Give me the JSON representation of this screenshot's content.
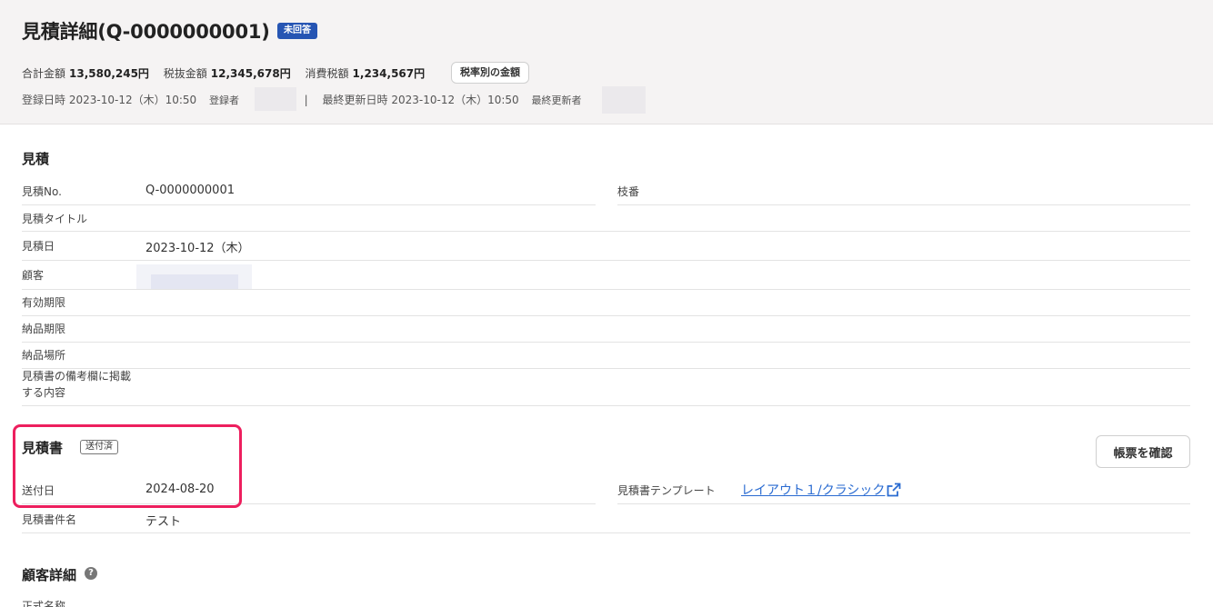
{
  "header": {
    "title": "見積詳細(Q-0000000001)",
    "status_badge": "未回答",
    "amounts": [
      {
        "label": "合計金額",
        "value": "13,580,245円"
      },
      {
        "label": "税抜金額",
        "value": "12,345,678円"
      },
      {
        "label": "消費税額",
        "value": "1,234,567円"
      }
    ],
    "tax_button": "税率別の金額",
    "registered_at_label": "登録日時",
    "registered_at": "2023-10-12（木）10:50",
    "registered_by_label": "登録者",
    "separator": "|",
    "updated_at_label": "最終更新日時",
    "updated_at": "2023-10-12（木）10:50",
    "updated_by_label": "最終更新者"
  },
  "estimate": {
    "title": "見積",
    "no_label": "見積No.",
    "no_value": "Q-0000000001",
    "branch_label": "枝番",
    "title_label": "見積タイトル",
    "date_label": "見積日",
    "date_value": "2023-10-12（木）",
    "customer_label": "顧客",
    "valid_label": "有効期限",
    "delivery_deadline_label": "納品期限",
    "delivery_place_label": "納品場所",
    "remarks_label_1": "見積書の備考欄に掲載",
    "remarks_label_2": "する内容"
  },
  "document": {
    "title": "見積書",
    "sent_badge": "送付済",
    "confirm_button": "帳票を確認",
    "sent_date_label": "送付日",
    "sent_date_value": "2024-08-20",
    "template_label": "見積書テンプレート",
    "template_link": "レイアウト１/クラシック",
    "doc_name_label": "見積書件名",
    "doc_name_value": "テスト"
  },
  "customer_detail": {
    "title": "顧客詳細",
    "help": "?",
    "official_name_label": "正式名称"
  },
  "colors": {
    "badge_blue": "#2655b3",
    "highlight": "#ed1f5e",
    "link": "#2a6bd1",
    "header_bg": "#f5f3f3"
  }
}
